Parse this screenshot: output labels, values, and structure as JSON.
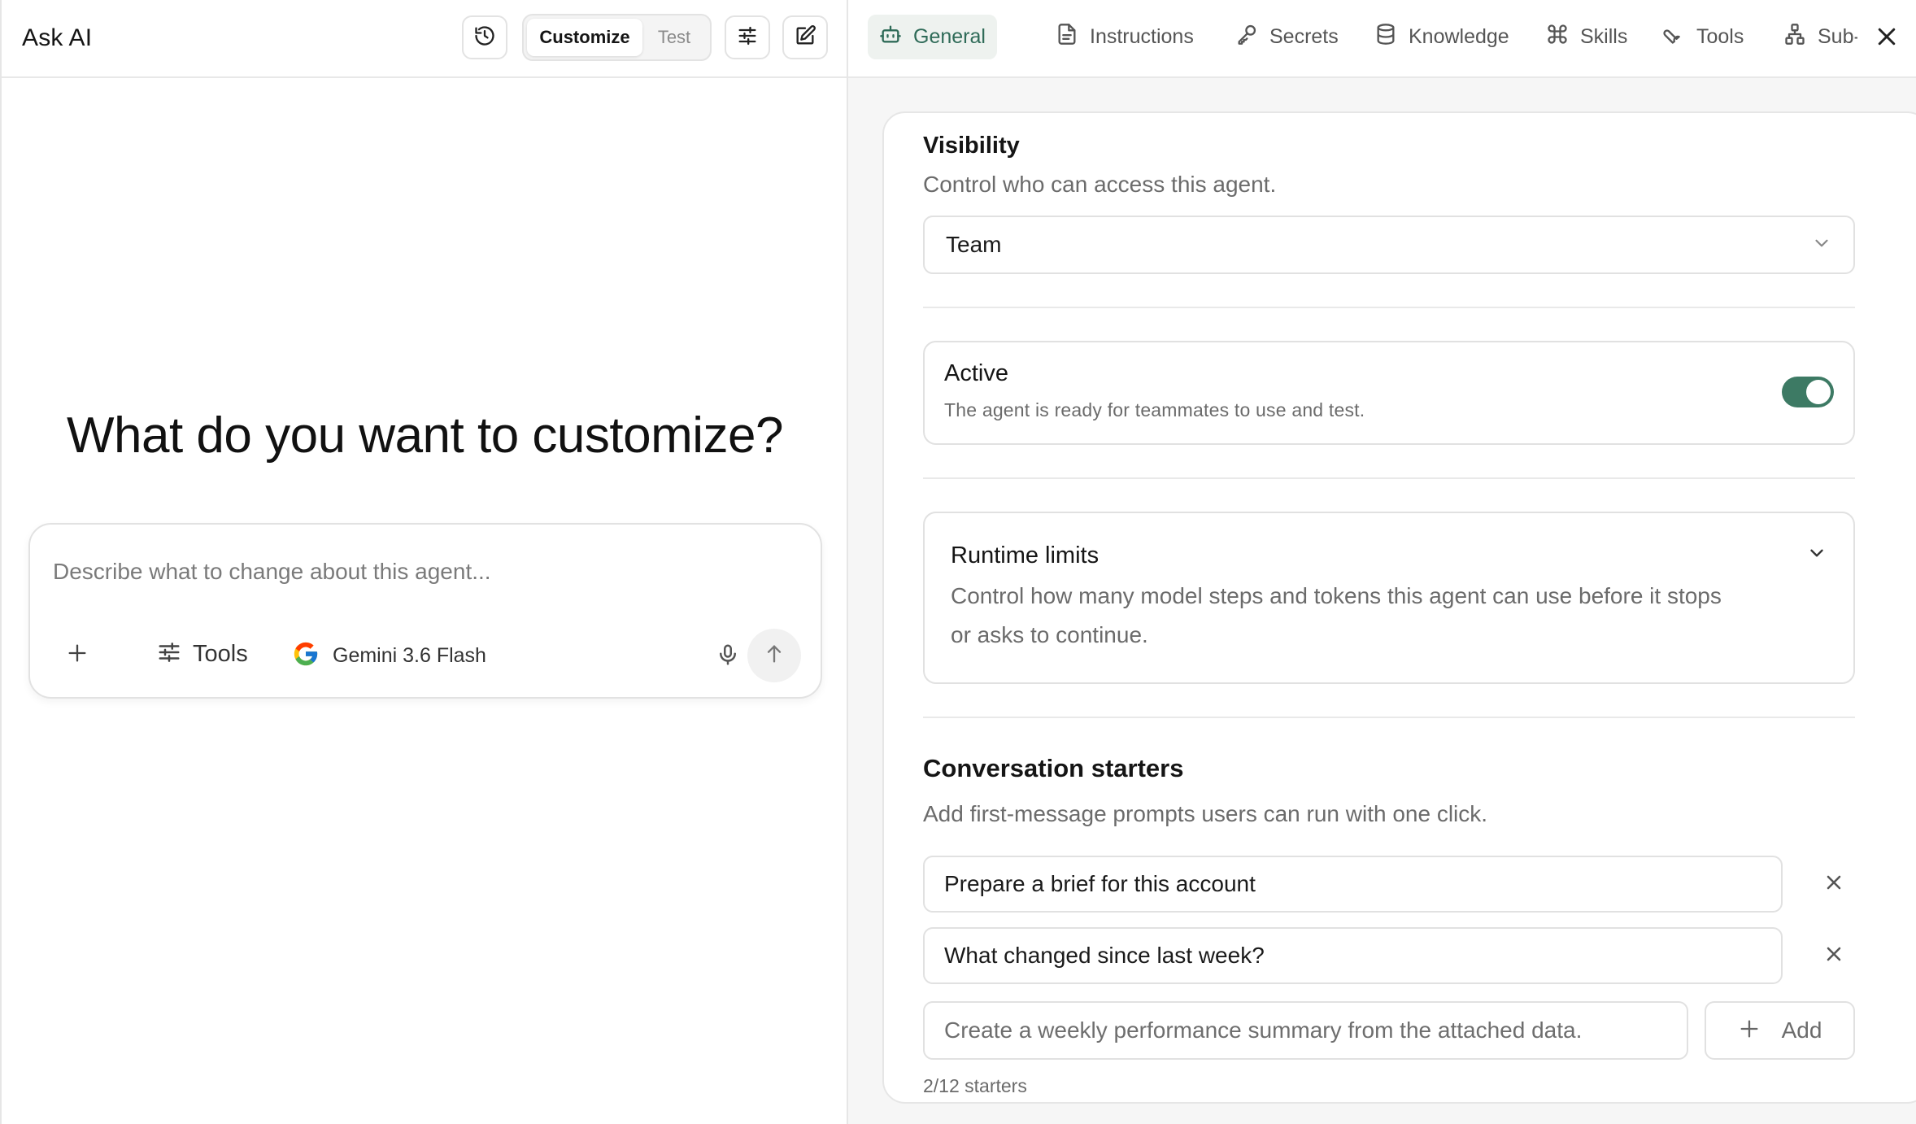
{
  "left": {
    "title": "Ask AI",
    "segments": {
      "customize": "Customize",
      "test": "Test"
    },
    "hero": "What do you want to customize?",
    "composer": {
      "placeholder": "Describe what to change about this agent...",
      "tools_label": "Tools",
      "model_label": "Gemini 3.6 Flash"
    }
  },
  "tabs": [
    {
      "label": "General",
      "icon": "robot-icon",
      "active": true
    },
    {
      "label": "Instructions",
      "icon": "document-icon",
      "active": false
    },
    {
      "label": "Secrets",
      "icon": "key-icon",
      "active": false
    },
    {
      "label": "Knowledge",
      "icon": "database-icon",
      "active": false
    },
    {
      "label": "Skills",
      "icon": "command-icon",
      "active": false
    },
    {
      "label": "Tools",
      "icon": "wrench-icon",
      "active": false
    },
    {
      "label": "Sub-a",
      "icon": "hierarchy-icon",
      "active": false
    }
  ],
  "settings": {
    "visibility": {
      "title": "Visibility",
      "description": "Control who can access this agent.",
      "value": "Team"
    },
    "active": {
      "title": "Active",
      "description": "The agent is ready for teammates to use and test.",
      "enabled": true
    },
    "runtime": {
      "title": "Runtime limits",
      "description_line1": "Control how many model steps and tokens this agent can use before it stops",
      "description_line2": "or asks to continue."
    },
    "starters": {
      "title": "Conversation starters",
      "description": "Add first-message prompts users can run with one click.",
      "items": [
        "Prepare a brief for this account",
        "What changed since last week?"
      ],
      "new_placeholder": "Create a weekly performance summary from the attached data.",
      "add_label": "Add",
      "count": "2/12 starters"
    }
  },
  "colors": {
    "accent": "#2f6b58",
    "toggle_on": "#3d7a64",
    "active_tab_bg": "#eef2ef"
  }
}
